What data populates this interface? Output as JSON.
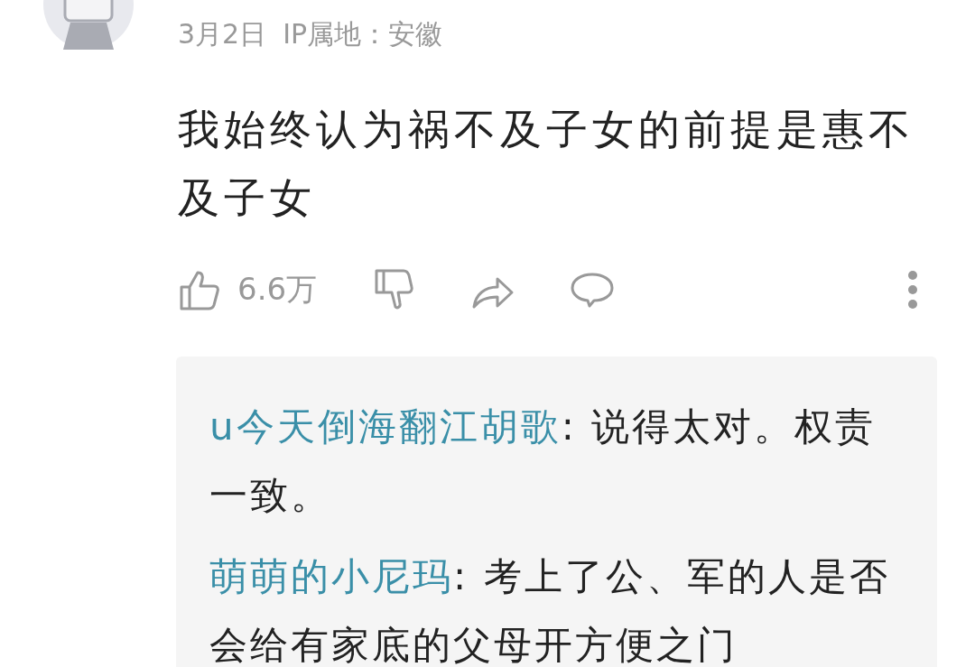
{
  "comment": {
    "date": "3月2日",
    "location": "IP属地：安徽",
    "text": "我始终认为祸不及子女的前提是惠不及子女",
    "likes": "6.6万"
  },
  "replies": [
    {
      "name": "u今天倒海翻江胡歌",
      "text": ": 说得太对。权责一致。"
    },
    {
      "name": "萌萌的小尼玛",
      "text": ": 考上了公、军的人是否会给有家底的父母开方便之门"
    }
  ]
}
